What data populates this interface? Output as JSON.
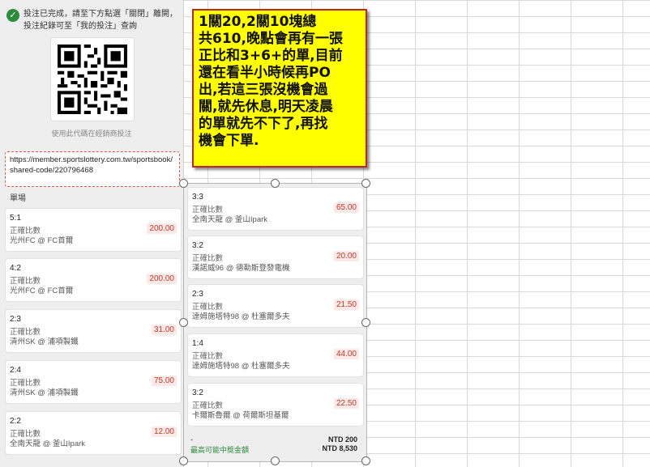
{
  "notice": {
    "icon": "check-circle-icon",
    "text": "投注已完成，請至下方點選「關閉」離開，投注紀錄可至「我的投注」查詢"
  },
  "qr": {
    "caption": "使用此代碼在經銷商投注"
  },
  "share_url": "https://member.sportslottery.com.tw/sportsbook/shared-code/220796468",
  "section_label": "單場",
  "left_bets": [
    {
      "score": "5:1",
      "type": "正確比數",
      "match": "光州FC @ FC首爾",
      "odds": "200.00"
    },
    {
      "score": "4:2",
      "type": "正確比數",
      "match": "光州FC @ FC首爾",
      "odds": "200.00"
    },
    {
      "score": "2:3",
      "type": "正確比數",
      "match": "清州SK @ 浦項製鐵",
      "odds": "31.00"
    },
    {
      "score": "2:4",
      "type": "正確比數",
      "match": "清州SK @ 浦項製鐵",
      "odds": "75.00"
    },
    {
      "score": "2:2",
      "type": "正確比數",
      "match": "全南天龍 @ 釜山Ipark",
      "odds": "12.00"
    }
  ],
  "right_bets": [
    {
      "score": "3:3",
      "type": "正確比數",
      "match": "全南天龍 @ 釜山Ipark",
      "odds": "65.00"
    },
    {
      "score": "3:2",
      "type": "正確比數",
      "match": "漢諾威96 @ 德勒斯登發電機",
      "odds": "20.00"
    },
    {
      "score": "2:3",
      "type": "正確比數",
      "match": "達姆施塔特98 @ 杜塞爾多夫",
      "odds": "21.50"
    },
    {
      "score": "1:4",
      "type": "正確比數",
      "match": "達姆施塔特98 @ 杜塞爾多夫",
      "odds": "44.00"
    },
    {
      "score": "3:2",
      "type": "正確比數",
      "match": "卡爾斯魯爾 @ 荷爾斯坦基爾",
      "odds": "22.50"
    }
  ],
  "totals": {
    "dash": "-",
    "label": "最高可能中獎金額",
    "stake": "NTD 200",
    "max_payout": "NTD 8,530"
  },
  "note": {
    "lines": [
      "1關20,2關10塊總",
      "共610,晚點會再有一張",
      "正比和3+6+的單,目前",
      "還在看半小時候再PO",
      "出,若這三張沒機會過",
      "關,就先休息,明天凌晨",
      "的單就先不下了,再找",
      "機會下單."
    ]
  },
  "colors": {
    "note_bg": "#ffff00",
    "note_border": "#c0272d",
    "odds_red": "#c0392b",
    "success_green": "#2e8b3e"
  }
}
